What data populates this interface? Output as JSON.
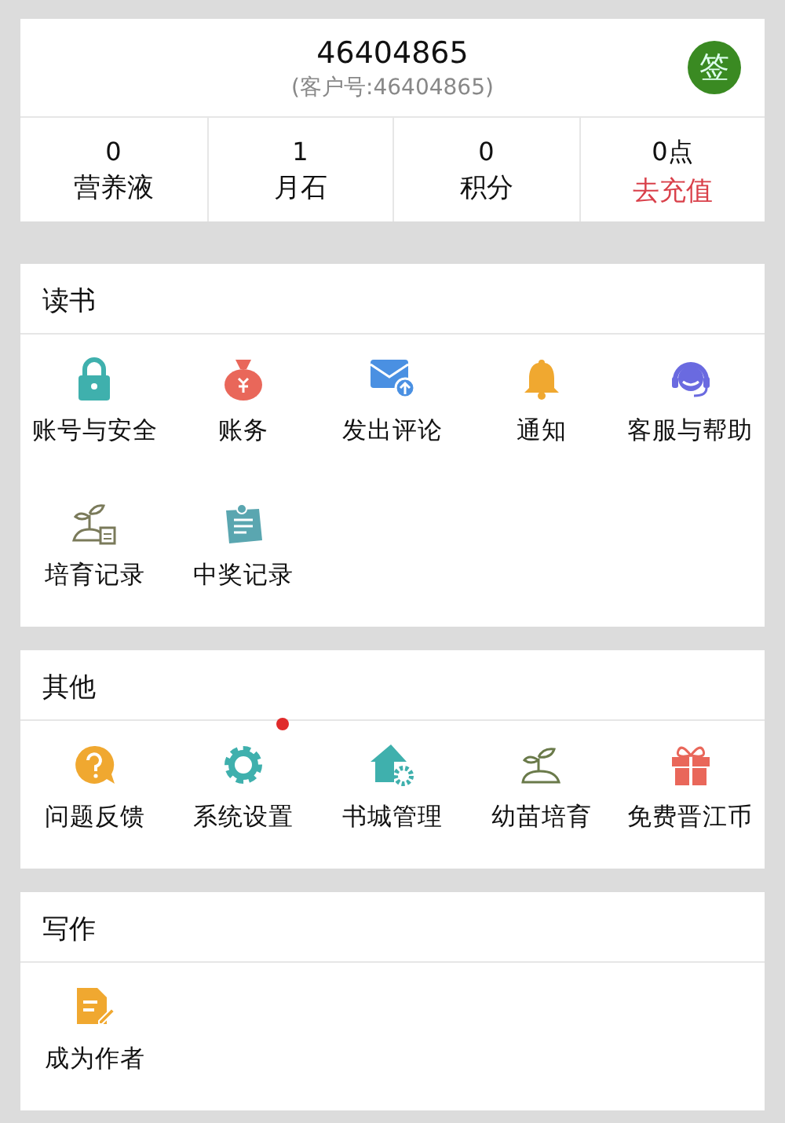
{
  "account": {
    "name": "46404865",
    "customer_id": "(客户号:46404865)",
    "sign_label": "签"
  },
  "stats": [
    {
      "value": "0",
      "label": "营养液",
      "kind": "plain"
    },
    {
      "value": "1",
      "label": "月石",
      "kind": "plain"
    },
    {
      "value": "0",
      "label": "积分",
      "kind": "plain"
    },
    {
      "value": "0点",
      "label": "去充值",
      "kind": "link"
    }
  ],
  "sections": [
    {
      "title": "读书",
      "items": [
        {
          "label": "账号与安全",
          "kind": "lock",
          "badge": false
        },
        {
          "label": "账务",
          "kind": "moneybag",
          "badge": false
        },
        {
          "label": "发出评论",
          "kind": "mail",
          "badge": false
        },
        {
          "label": "通知",
          "kind": "bell",
          "badge": false
        },
        {
          "label": "客服与帮助",
          "kind": "headset",
          "badge": false
        },
        {
          "label": "培育记录",
          "kind": "sproutdoc",
          "badge": false
        },
        {
          "label": "中奖记录",
          "kind": "note",
          "badge": false
        }
      ]
    },
    {
      "title": "其他",
      "items": [
        {
          "label": "问题反馈",
          "kind": "question",
          "badge": false
        },
        {
          "label": "系统设置",
          "kind": "gear",
          "badge": true
        },
        {
          "label": "书城管理",
          "kind": "house",
          "badge": false
        },
        {
          "label": "幼苗培育",
          "kind": "sprout",
          "badge": false
        },
        {
          "label": "免费晋江币",
          "kind": "gift",
          "badge": false
        }
      ]
    },
    {
      "title": "写作",
      "items": [
        {
          "label": "成为作者",
          "kind": "edit",
          "badge": false
        }
      ]
    }
  ]
}
